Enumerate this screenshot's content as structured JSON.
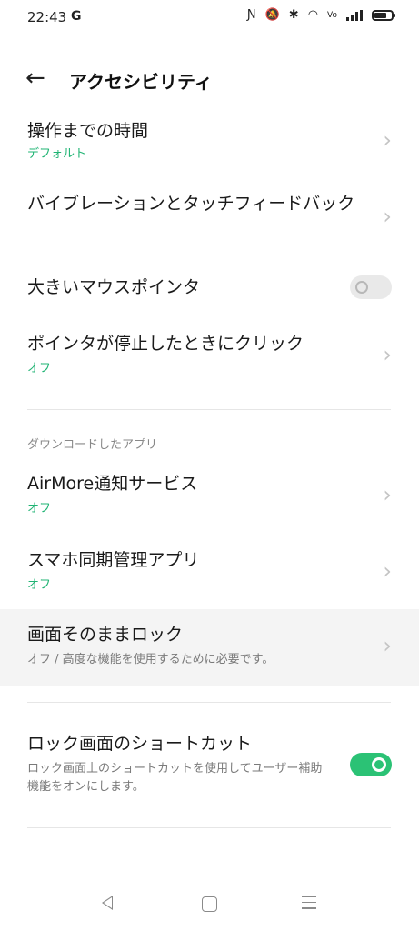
{
  "status": {
    "time": "22:43",
    "left_icon": "G"
  },
  "header": {
    "title": "アクセシビリティ"
  },
  "items": [
    {
      "label": "操作までの時間",
      "sub": "デフォルト"
    },
    {
      "label": "バイブレーションとタッチフィードバック"
    },
    {
      "label": "大きいマウスポインタ",
      "toggle": "off"
    },
    {
      "label": "ポインタが停止したときにクリック",
      "sub": "オフ"
    }
  ],
  "section": {
    "downloaded_apps": "ダウンロードしたアプリ"
  },
  "apps": [
    {
      "label": "AirMore通知サービス",
      "sub": "オフ"
    },
    {
      "label": "スマホ同期管理アプリ",
      "sub": "オフ"
    },
    {
      "label": "画面そのままロック",
      "sub": "オフ / 高度な機能を使用するために必要です。"
    }
  ],
  "shortcut": {
    "label": "ロック画面のショートカット",
    "sub": "ロック画面上のショートカットを使用してユーザー補助機能をオンにします。",
    "toggle": "on"
  },
  "colors": {
    "accent": "#2bc275",
    "sub_green": "#20b474"
  }
}
